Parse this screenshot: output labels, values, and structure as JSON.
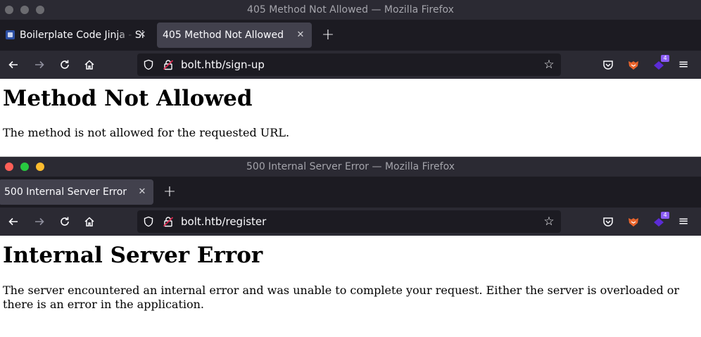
{
  "window1": {
    "title": "405 Method Not Allowed — Mozilla Firefox",
    "tabs": [
      {
        "label": "Boilerplate Code Jinja - Si",
        "active": false
      },
      {
        "label": "405 Method Not Allowed",
        "active": true
      }
    ],
    "url": "bolt.htb/sign-up",
    "extension_badge": "4",
    "page": {
      "heading": "Method Not Allowed",
      "message": "The method is not allowed for the requested URL."
    }
  },
  "window2": {
    "title": "500 Internal Server Error — Mozilla Firefox",
    "tabs": [
      {
        "label": "500 Internal Server Error",
        "active": true
      }
    ],
    "url": "bolt.htb/register",
    "extension_badge": "4",
    "page": {
      "heading": "Internal Server Error",
      "message": "The server encountered an internal error and was unable to complete your request. Either the server is overloaded or there is an error in the application."
    }
  },
  "icons": {
    "close": "✕",
    "new_tab": "+",
    "back": "←",
    "forward": "→",
    "reload": "↻",
    "star": "☆",
    "menu": "≡"
  },
  "colors": {
    "titlebar": "#2b2a33",
    "tabbar": "#1c1b22",
    "active_tab": "#42414d",
    "traffic_red": "#ff5f57",
    "traffic_green": "#28c840",
    "traffic_yellow": "#febc2e",
    "badge": "#8a5cf5"
  }
}
